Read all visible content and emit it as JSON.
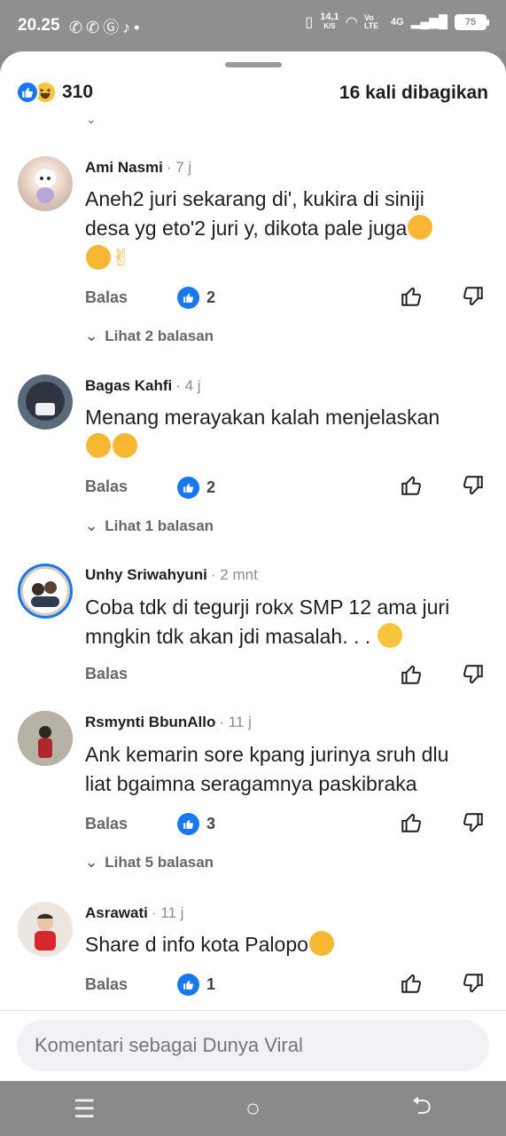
{
  "status": {
    "time": "20.25",
    "speed": "14,1",
    "speed_unit": "K/S",
    "network": "4G",
    "volte": "Vo LTE",
    "battery": "75"
  },
  "header": {
    "reaction_count": "310",
    "shares": "16 kali dibagikan"
  },
  "comments": [
    {
      "name": "Ami Nasmi",
      "time": "· 7 j",
      "line1": "Aneh2 juri sekarang di', kukira di siniji",
      "line2": "desa yg eto'2 juri y, dikota pale juga",
      "reply": "Balas",
      "likes": "2",
      "more": "Lihat 2 balasan"
    },
    {
      "name": "Bagas Kahfi",
      "time": "· 4 j",
      "line1": "Menang merayakan kalah menjelaskan",
      "reply": "Balas",
      "likes": "2",
      "more": "Lihat 1 balasan"
    },
    {
      "name": "Unhy Sriwahyuni",
      "time": "· 2 mnt",
      "line1": "Coba tdk di tegurji rokx SMP 12 ama juri",
      "line2": "mngkin tdk akan jdi masalah. . . ",
      "reply": "Balas"
    },
    {
      "name": "Rsmynti BbunAllo",
      "time": "· 11 j",
      "line1": "Ank kemarin sore kpang jurinya sruh dlu",
      "line2": "liat bgaimna seragamnya paskibraka",
      "reply": "Balas",
      "likes": "3",
      "more": "Lihat 5 balasan"
    },
    {
      "name": "Asrawati",
      "time": "· 11 j",
      "line1": "Share d info kota Palopo",
      "reply": "Balas",
      "likes": "1"
    }
  ],
  "composer": {
    "placeholder": "Komentari sebagai Dunya Viral"
  },
  "colors": {
    "accent": "#1877f2",
    "emoji": "#f7b733"
  }
}
